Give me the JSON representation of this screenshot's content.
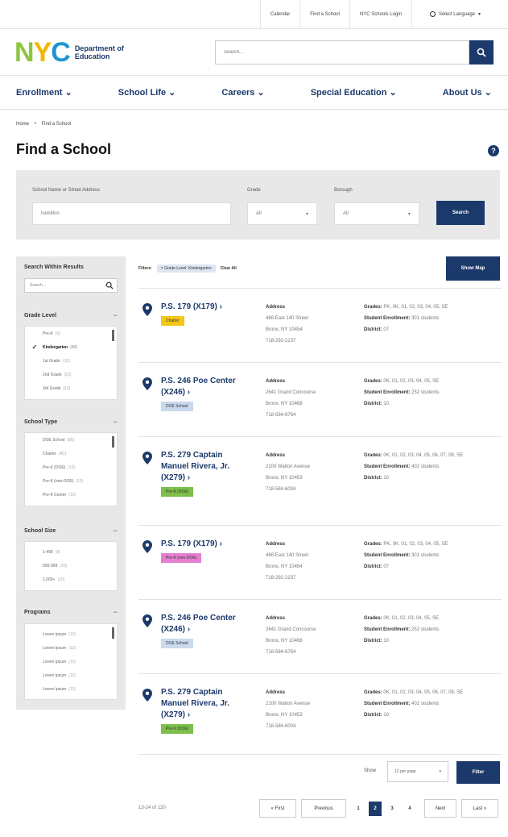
{
  "utility": {
    "links": [
      "Calendar",
      "Find a School",
      "NYC Schools Login"
    ],
    "language": "Select Language"
  },
  "brand": {
    "logo_letters": [
      "N",
      "Y",
      "C"
    ],
    "logo_text": "Department of Education",
    "search_placeholder": "Search..."
  },
  "nav": {
    "items": [
      "Enrollment",
      "School Life",
      "Careers",
      "Special Education",
      "About Us"
    ]
  },
  "breadcrumb": {
    "home": "Home",
    "separator": "•",
    "current": "Find a School"
  },
  "page": {
    "title": "Find a School",
    "help": "?"
  },
  "search_form": {
    "name_label": "School Name or Street Address",
    "name_value": "hamilton",
    "grade_label": "Grade",
    "grade_value": "All",
    "borough_label": "Borough",
    "borough_value": "All",
    "search_label": "Search"
  },
  "sidebar": {
    "search_title": "Search Within Results",
    "search_placeholder": "Search...",
    "sections": [
      {
        "title": "Grade Level",
        "items": [
          {
            "label": "Pre-K",
            "count": "(5)",
            "checked": false
          },
          {
            "label": "Kindergarten",
            "count": "(89)",
            "checked": true
          },
          {
            "label": "1st Grade",
            "count": "(10)",
            "checked": false
          },
          {
            "label": "2nd Grade",
            "count": "(10)",
            "checked": false
          },
          {
            "label": "3rd Grade",
            "count": "(10)",
            "checked": false
          }
        ]
      },
      {
        "title": "School Type",
        "items": [
          {
            "label": "DOE School",
            "count": "(85)",
            "checked": false
          },
          {
            "label": "Charter",
            "count": "(4C)",
            "checked": false
          },
          {
            "label": "Pre-K (DOE)",
            "count": "(13)",
            "checked": false
          },
          {
            "label": "Pre-K (non-DOE)",
            "count": "(13)",
            "checked": false
          },
          {
            "label": "Pre-K Center",
            "count": "(10)",
            "checked": false
          }
        ]
      },
      {
        "title": "School Size",
        "items": [
          {
            "label": "1-499",
            "count": "(8)",
            "checked": false
          },
          {
            "label": "500-999",
            "count": "(10)",
            "checked": false
          },
          {
            "label": "1,000+",
            "count": "(10)",
            "checked": false
          }
        ]
      },
      {
        "title": "Programs",
        "items": [
          {
            "label": "Lorem Ipsum",
            "count": "(13)",
            "checked": false
          },
          {
            "label": "Lorem Ipsum",
            "count": "(13)",
            "checked": false
          },
          {
            "label": "Lorem Ipsum",
            "count": "(13)",
            "checked": false
          },
          {
            "label": "Lorem Ipsum",
            "count": "(13)",
            "checked": false
          },
          {
            "label": "Lorem Ipsum",
            "count": "(13)",
            "checked": false
          }
        ]
      }
    ]
  },
  "results_header": {
    "filters_label": "Filters:",
    "chip": "× Grade Level: Kindergarten",
    "clear_all": "Clear All",
    "show_map": "Show Map"
  },
  "results": [
    {
      "name": "P.S. 179 (X179)",
      "tag": "Charter",
      "tag_color": "#f5c518",
      "address_label": "Address",
      "street": "468 East 140 Street",
      "city": "Bronx, NY 10454",
      "phone": "718-292-2237",
      "grades_label": "Grades:",
      "grades": "PK, 0K, 01, 02, 03, 04, 05, SE",
      "enrollment_label": "Student Enrollment:",
      "enrollment": "301 students",
      "district_label": "District:",
      "district": "07"
    },
    {
      "name": "P.S. 246 Poe Center (X246)",
      "tag": "DOE School",
      "tag_color": "#c9d9ee",
      "address_label": "Address",
      "street": "2641 Grand Concourse",
      "city": "Bronx, NY 10468",
      "phone": "718-584-6764",
      "grades_label": "Grades:",
      "grades": "0K, 01, 02, 03, 04, 05, SE",
      "enrollment_label": "Student Enrollment:",
      "enrollment": "252 students",
      "district_label": "District:",
      "district": "10"
    },
    {
      "name": "P.S. 279 Captain Manuel Rivera, Jr. (X279)",
      "tag": "Pre-K (DOE)",
      "tag_color": "#7cbf4a",
      "address_label": "Address",
      "street": "2100 Walton Avenue",
      "city": "Bronx, NY 10453",
      "phone": "718-584-6004",
      "grades_label": "Grades:",
      "grades": "0K, 01, 02, 03, 04, 05, 06, 07, 08, SE",
      "enrollment_label": "Student Enrollment:",
      "enrollment": "402 students",
      "district_label": "District:",
      "district": "10"
    },
    {
      "name": "P.S. 179 (X179)",
      "tag": "Pre-K (non-DOE)",
      "tag_color": "#e57fd0",
      "address_label": "Address",
      "street": "468 East 140 Street",
      "city": "Bronx, NY 10454",
      "phone": "718-292-2237",
      "grades_label": "Grades:",
      "grades": "PK, 0K, 01, 02, 03, 04, 05, SE",
      "enrollment_label": "Student Enrollment:",
      "enrollment": "301 students",
      "district_label": "District:",
      "district": "07"
    },
    {
      "name": "P.S. 246 Poe Center (X246)",
      "tag": "DOE School",
      "tag_color": "#c9d9ee",
      "address_label": "Address",
      "street": "2641 Grand Concourse",
      "city": "Bronx, NY 10468",
      "phone": "718-584-6764",
      "grades_label": "Grades:",
      "grades": "0K, 01, 02, 03, 04, 05, SE",
      "enrollment_label": "Student Enrollment:",
      "enrollment": "252 students",
      "district_label": "District:",
      "district": "10"
    },
    {
      "name": "P.S. 279 Captain Manuel Rivera, Jr. (X279)",
      "tag": "Pre-K (DOE)",
      "tag_color": "#7cbf4a",
      "address_label": "Address",
      "street": "2100 Walton Avenue",
      "city": "Bronx, NY 10453",
      "phone": "718-584-6004",
      "grades_label": "Grades:",
      "grades": "0K, 01, 02, 03, 04, 05, 06, 07, 08, SE",
      "enrollment_label": "Student Enrollment:",
      "enrollment": "402 students",
      "district_label": "District:",
      "district": "10"
    }
  ],
  "pagination": {
    "show_label": "Show",
    "per_page": "12 per page",
    "filter_label": "Filter",
    "count": "13-24 of 120",
    "first": "« First",
    "previous": "Previous",
    "pages": [
      "1",
      "2",
      "3",
      "4"
    ],
    "active_page": "2",
    "next": "Next",
    "last": "Last »"
  },
  "colors": {
    "navy": "#1b3a6b",
    "panel": "#e8e8e8"
  }
}
